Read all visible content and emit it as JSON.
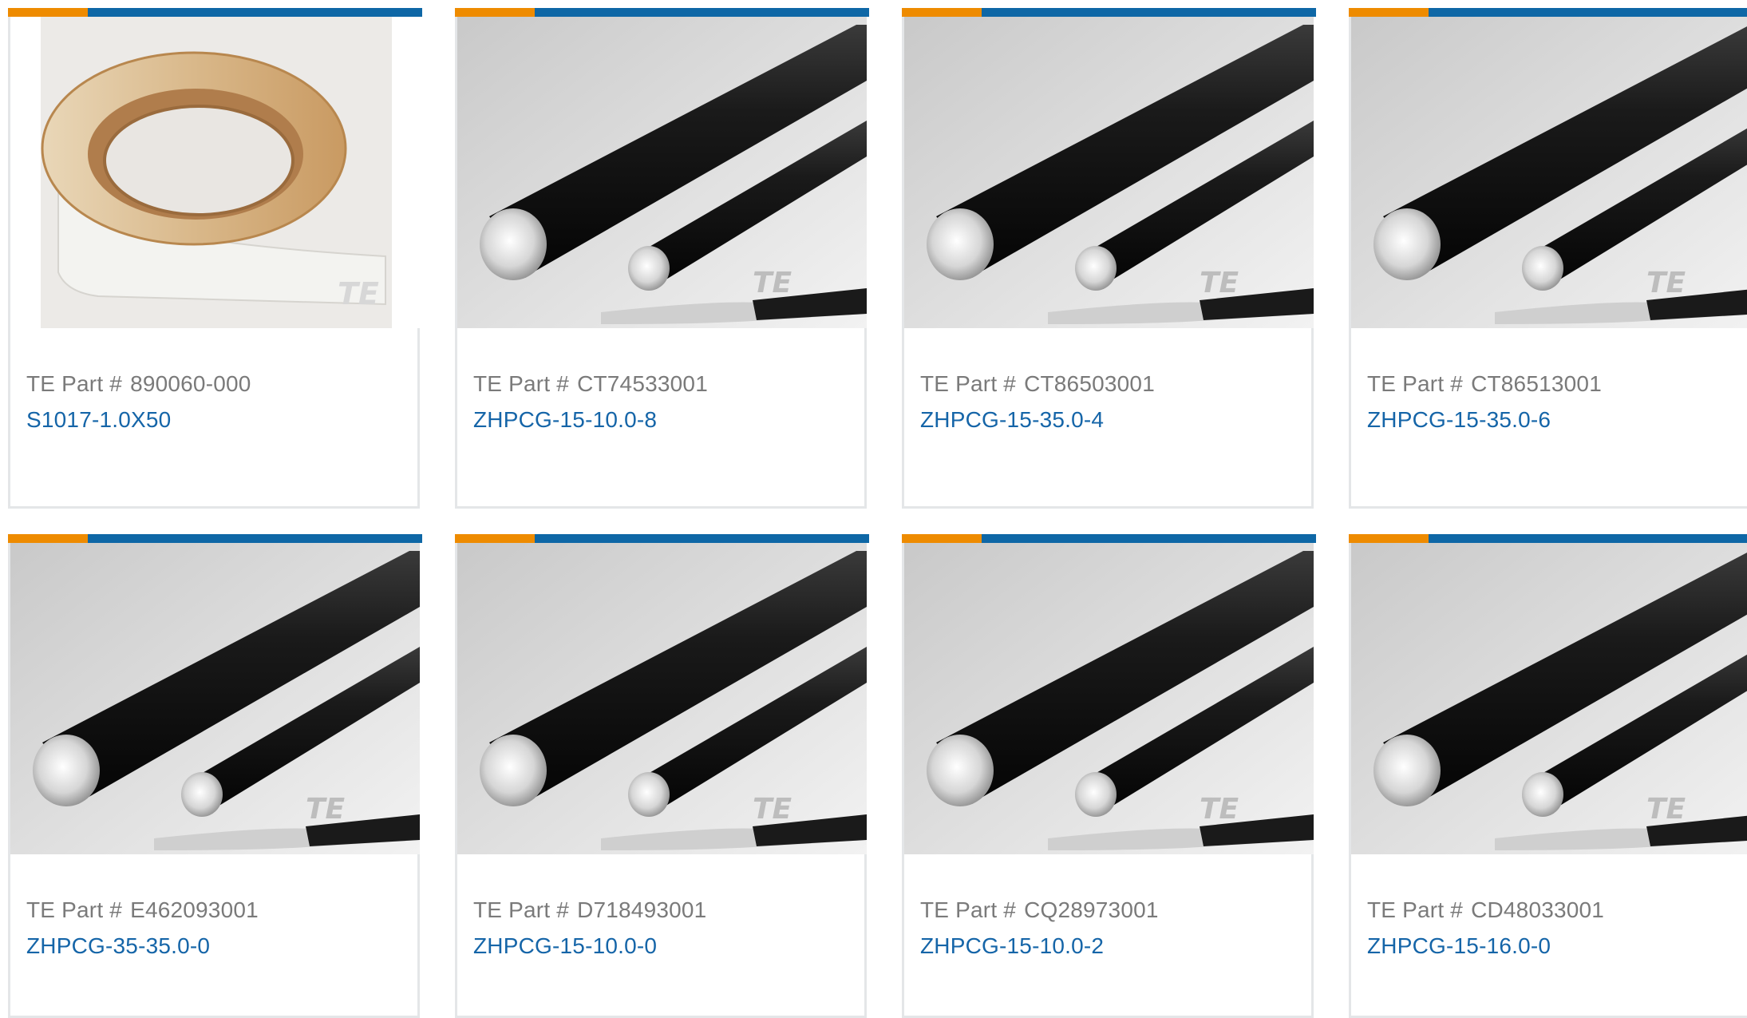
{
  "accent_colors": {
    "orange": "#ee8b00",
    "blue": "#0e67a6",
    "link": "#1565a8",
    "meta": "#7a7a7a"
  },
  "part_prefix": "TE Part #",
  "products": [
    {
      "part_number": "890060-000",
      "product_name": "S1017-1.0X50",
      "image": "tape-roll-image"
    },
    {
      "part_number": "CT74533001",
      "product_name": "ZHPCG-15-10.0-8",
      "image": "cable-image"
    },
    {
      "part_number": "CT86503001",
      "product_name": "ZHPCG-15-35.0-4",
      "image": "cable-image"
    },
    {
      "part_number": "CT86513001",
      "product_name": "ZHPCG-15-35.0-6",
      "image": "cable-image"
    },
    {
      "part_number": "E462093001",
      "product_name": "ZHPCG-35-35.0-0",
      "image": "cable-image"
    },
    {
      "part_number": "D718493001",
      "product_name": "ZHPCG-15-10.0-0",
      "image": "cable-image"
    },
    {
      "part_number": "CQ28973001",
      "product_name": "ZHPCG-15-10.0-2",
      "image": "cable-image"
    },
    {
      "part_number": "CD48033001",
      "product_name": "ZHPCG-15-16.0-0",
      "image": "cable-image"
    }
  ]
}
